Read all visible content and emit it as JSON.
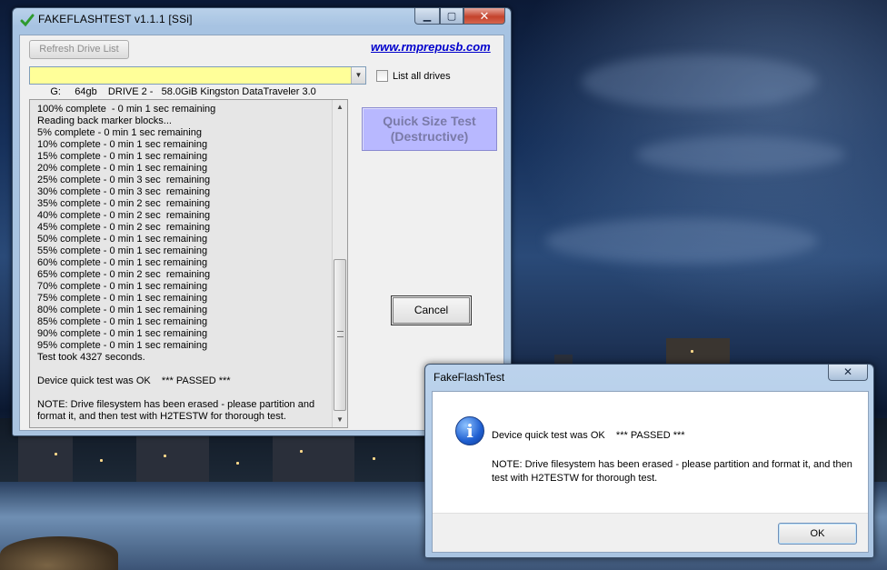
{
  "main_window": {
    "title": "FAKEFLASHTEST v1.1.1  [SSi]",
    "caption": {
      "minimize": "▁",
      "maximize": "▢",
      "close": "✕"
    },
    "refresh_label": "Refresh Drive List",
    "site_link": "www.rmprepusb.com",
    "drive_select_value": "G:     64gb    DRIVE 2 -   58.0GiB Kingston DataTraveler 3.0",
    "list_all_label": "List all drives",
    "log": "100% complete  - 0 min 1 sec remaining\nReading back marker blocks...\n5% complete - 0 min 1 sec remaining\n10% complete - 0 min 1 sec remaining\n15% complete - 0 min 1 sec remaining\n20% complete - 0 min 1 sec remaining\n25% complete - 0 min 3 sec  remaining\n30% complete - 0 min 3 sec  remaining\n35% complete - 0 min 2 sec  remaining\n40% complete - 0 min 2 sec  remaining\n45% complete - 0 min 2 sec  remaining\n50% complete - 0 min 1 sec remaining\n55% complete - 0 min 1 sec remaining\n60% complete - 0 min 1 sec remaining\n65% complete - 0 min 2 sec  remaining\n70% complete - 0 min 1 sec remaining\n75% complete - 0 min 1 sec remaining\n80% complete - 0 min 1 sec remaining\n85% complete - 0 min 1 sec remaining\n90% complete - 0 min 1 sec remaining\n95% complete - 0 min 1 sec remaining\nTest took 4327 seconds.\n\nDevice quick test was OK    *** PASSED ***\n\nNOTE: Drive filesystem has been erased - please partition and format it, and then test with H2TESTW for thorough test.",
    "quick_test_line1": "Quick Size Test",
    "quick_test_line2": "(Destructive)",
    "cancel_label": "Cancel"
  },
  "message_box": {
    "title": "FakeFlashTest",
    "close": "✕",
    "line1": "Device quick test was OK    *** PASSED ***",
    "line2": "NOTE: Drive filesystem has been erased - please partition and format it, and then test with H2TESTW for thorough test.",
    "ok_label": "OK",
    "icon": "info-icon"
  },
  "colors": {
    "drive_select_bg": "#ffff99",
    "quick_button_bg": "#b8b8ff",
    "link": "#0000cc"
  }
}
